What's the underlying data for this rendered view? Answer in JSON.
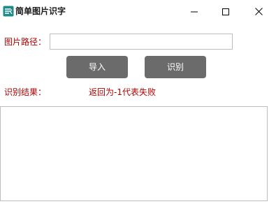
{
  "window": {
    "title": "简单图片识字",
    "icons": {
      "app": "app-logo-icon",
      "minimize": "minimize-icon",
      "maximize": "maximize-icon",
      "close": "close-icon"
    }
  },
  "form": {
    "path_label": "图片路径：",
    "path_value": "",
    "import_label": "导入",
    "recognize_label": "识别",
    "result_label": "识别结果：",
    "result_note": "返回为-1代表失败",
    "result_value": ""
  },
  "colors": {
    "label_red": "#b00000",
    "button_gray": "#6b6b6b",
    "icon_teal": "#1f8a8a"
  }
}
